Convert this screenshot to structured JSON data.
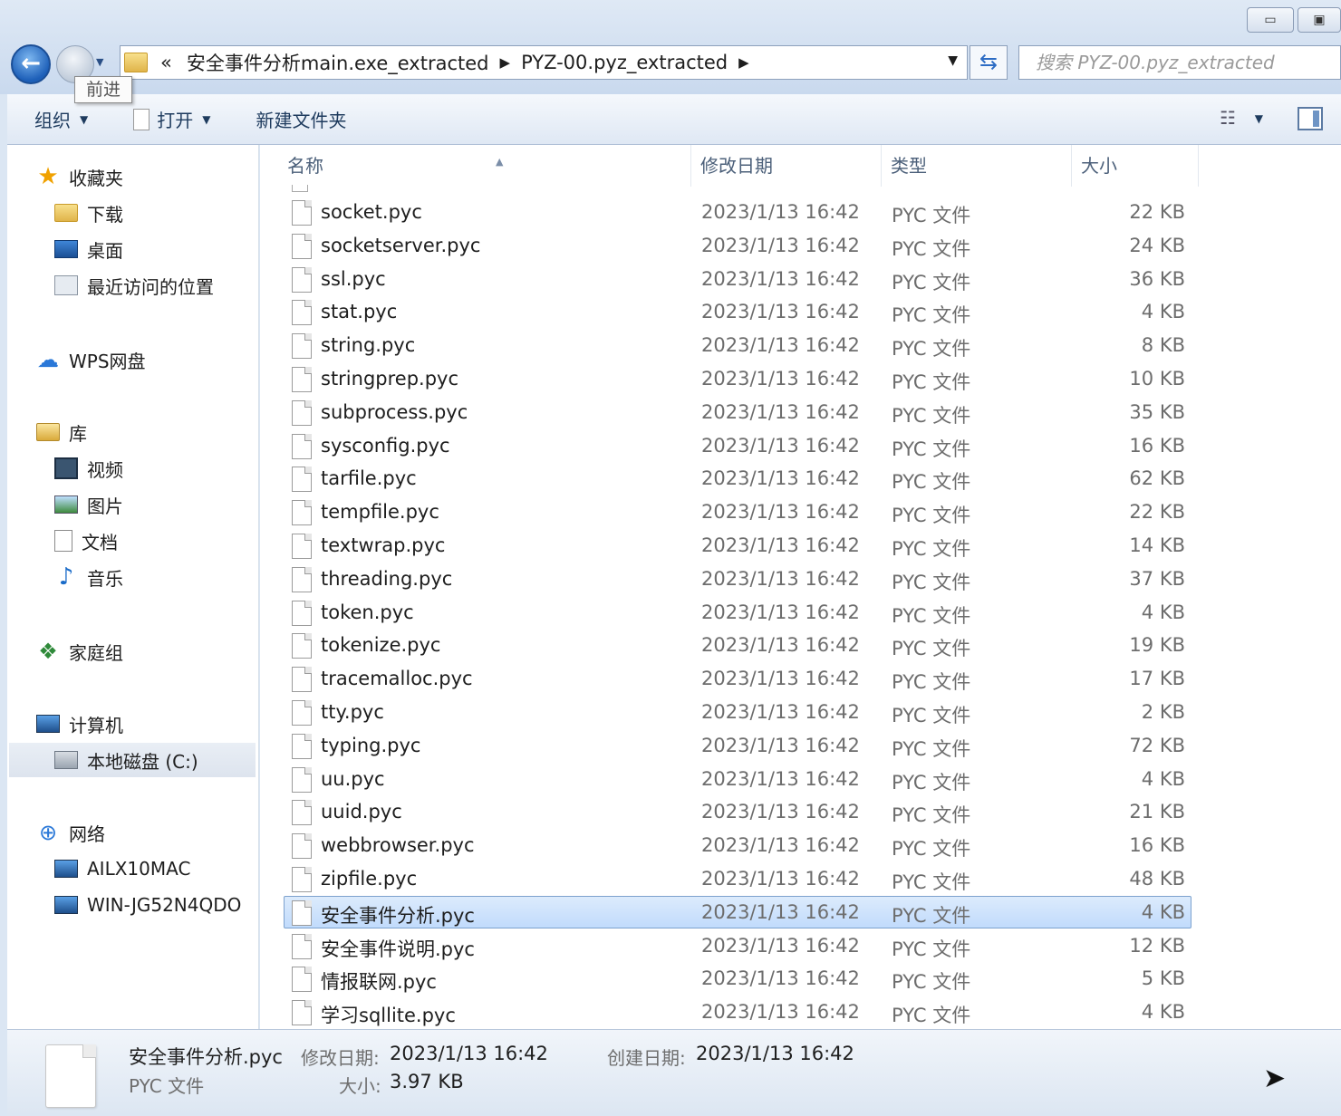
{
  "address": {
    "crumbs": [
      "安全事件分析main.exe_extracted",
      "PYZ-00.pyz_extracted"
    ],
    "overflow_chevron": "«",
    "search_placeholder": "搜索 PYZ-00.pyz_extracted",
    "forward_tooltip": "前进"
  },
  "toolbar": {
    "organize": "组织",
    "open": "打开",
    "new_folder": "新建文件夹"
  },
  "nav": {
    "favorites": "收藏夹",
    "downloads": "下载",
    "desktop": "桌面",
    "recent": "最近访问的位置",
    "wps": "WPS网盘",
    "libraries": "库",
    "videos": "视频",
    "pictures": "图片",
    "documents": "文档",
    "music": "音乐",
    "homegroup": "家庭组",
    "computer": "计算机",
    "local_disk": "本地磁盘 (C:)",
    "network": "网络",
    "net1": "AILX10MAC",
    "net2": "WIN-JG52N4QDO"
  },
  "columns": {
    "name": "名称",
    "date": "修改日期",
    "type": "类型",
    "size": "大小"
  },
  "files": [
    {
      "name": "socket.pyc",
      "date": "2023/1/13 16:42",
      "type": "PYC 文件",
      "size": "22 KB"
    },
    {
      "name": "socketserver.pyc",
      "date": "2023/1/13 16:42",
      "type": "PYC 文件",
      "size": "24 KB"
    },
    {
      "name": "ssl.pyc",
      "date": "2023/1/13 16:42",
      "type": "PYC 文件",
      "size": "36 KB"
    },
    {
      "name": "stat.pyc",
      "date": "2023/1/13 16:42",
      "type": "PYC 文件",
      "size": "4 KB"
    },
    {
      "name": "string.pyc",
      "date": "2023/1/13 16:42",
      "type": "PYC 文件",
      "size": "8 KB"
    },
    {
      "name": "stringprep.pyc",
      "date": "2023/1/13 16:42",
      "type": "PYC 文件",
      "size": "10 KB"
    },
    {
      "name": "subprocess.pyc",
      "date": "2023/1/13 16:42",
      "type": "PYC 文件",
      "size": "35 KB"
    },
    {
      "name": "sysconfig.pyc",
      "date": "2023/1/13 16:42",
      "type": "PYC 文件",
      "size": "16 KB"
    },
    {
      "name": "tarfile.pyc",
      "date": "2023/1/13 16:42",
      "type": "PYC 文件",
      "size": "62 KB"
    },
    {
      "name": "tempfile.pyc",
      "date": "2023/1/13 16:42",
      "type": "PYC 文件",
      "size": "22 KB"
    },
    {
      "name": "textwrap.pyc",
      "date": "2023/1/13 16:42",
      "type": "PYC 文件",
      "size": "14 KB"
    },
    {
      "name": "threading.pyc",
      "date": "2023/1/13 16:42",
      "type": "PYC 文件",
      "size": "37 KB"
    },
    {
      "name": "token.pyc",
      "date": "2023/1/13 16:42",
      "type": "PYC 文件",
      "size": "4 KB"
    },
    {
      "name": "tokenize.pyc",
      "date": "2023/1/13 16:42",
      "type": "PYC 文件",
      "size": "19 KB"
    },
    {
      "name": "tracemalloc.pyc",
      "date": "2023/1/13 16:42",
      "type": "PYC 文件",
      "size": "17 KB"
    },
    {
      "name": "tty.pyc",
      "date": "2023/1/13 16:42",
      "type": "PYC 文件",
      "size": "2 KB"
    },
    {
      "name": "typing.pyc",
      "date": "2023/1/13 16:42",
      "type": "PYC 文件",
      "size": "72 KB"
    },
    {
      "name": "uu.pyc",
      "date": "2023/1/13 16:42",
      "type": "PYC 文件",
      "size": "4 KB"
    },
    {
      "name": "uuid.pyc",
      "date": "2023/1/13 16:42",
      "type": "PYC 文件",
      "size": "21 KB"
    },
    {
      "name": "webbrowser.pyc",
      "date": "2023/1/13 16:42",
      "type": "PYC 文件",
      "size": "16 KB"
    },
    {
      "name": "zipfile.pyc",
      "date": "2023/1/13 16:42",
      "type": "PYC 文件",
      "size": "48 KB"
    },
    {
      "name": "安全事件分析.pyc",
      "date": "2023/1/13 16:42",
      "type": "PYC 文件",
      "size": "4 KB"
    },
    {
      "name": "安全事件说明.pyc",
      "date": "2023/1/13 16:42",
      "type": "PYC 文件",
      "size": "12 KB"
    },
    {
      "name": "情报联网.pyc",
      "date": "2023/1/13 16:42",
      "type": "PYC 文件",
      "size": "5 KB"
    },
    {
      "name": "学习sqllite.pyc",
      "date": "2023/1/13 16:42",
      "type": "PYC 文件",
      "size": "4 KB"
    }
  ],
  "selected_file": "安全事件分析.pyc",
  "details": {
    "name": "安全事件分析.pyc",
    "type": "PYC 文件",
    "modified_label": "修改日期:",
    "modified_value": "2023/1/13 16:42",
    "created_label": "创建日期:",
    "created_value": "2023/1/13 16:42",
    "size_label": "大小:",
    "size_value": "3.97 KB"
  }
}
